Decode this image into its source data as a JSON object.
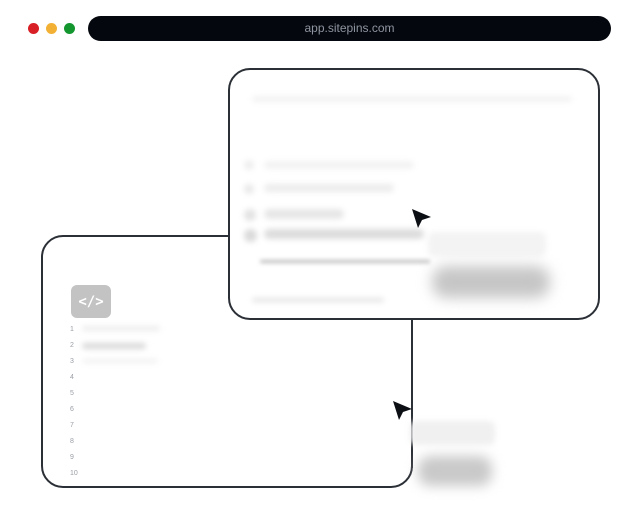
{
  "browser": {
    "url": "app.sitepins.com",
    "traffic_lights": [
      "#d81f26",
      "#f2b134",
      "#14962f"
    ]
  },
  "code_panel": {
    "icon": "code-brackets-icon",
    "icon_glyph": "</>",
    "line_numbers": [
      "1",
      "2",
      "3",
      "4",
      "5",
      "6",
      "7",
      "8",
      "9",
      "10"
    ]
  },
  "visual_panel": {
    "list_items": 4
  },
  "colors": {
    "frame": "#2b2f36",
    "urlbar": "#04070d"
  }
}
